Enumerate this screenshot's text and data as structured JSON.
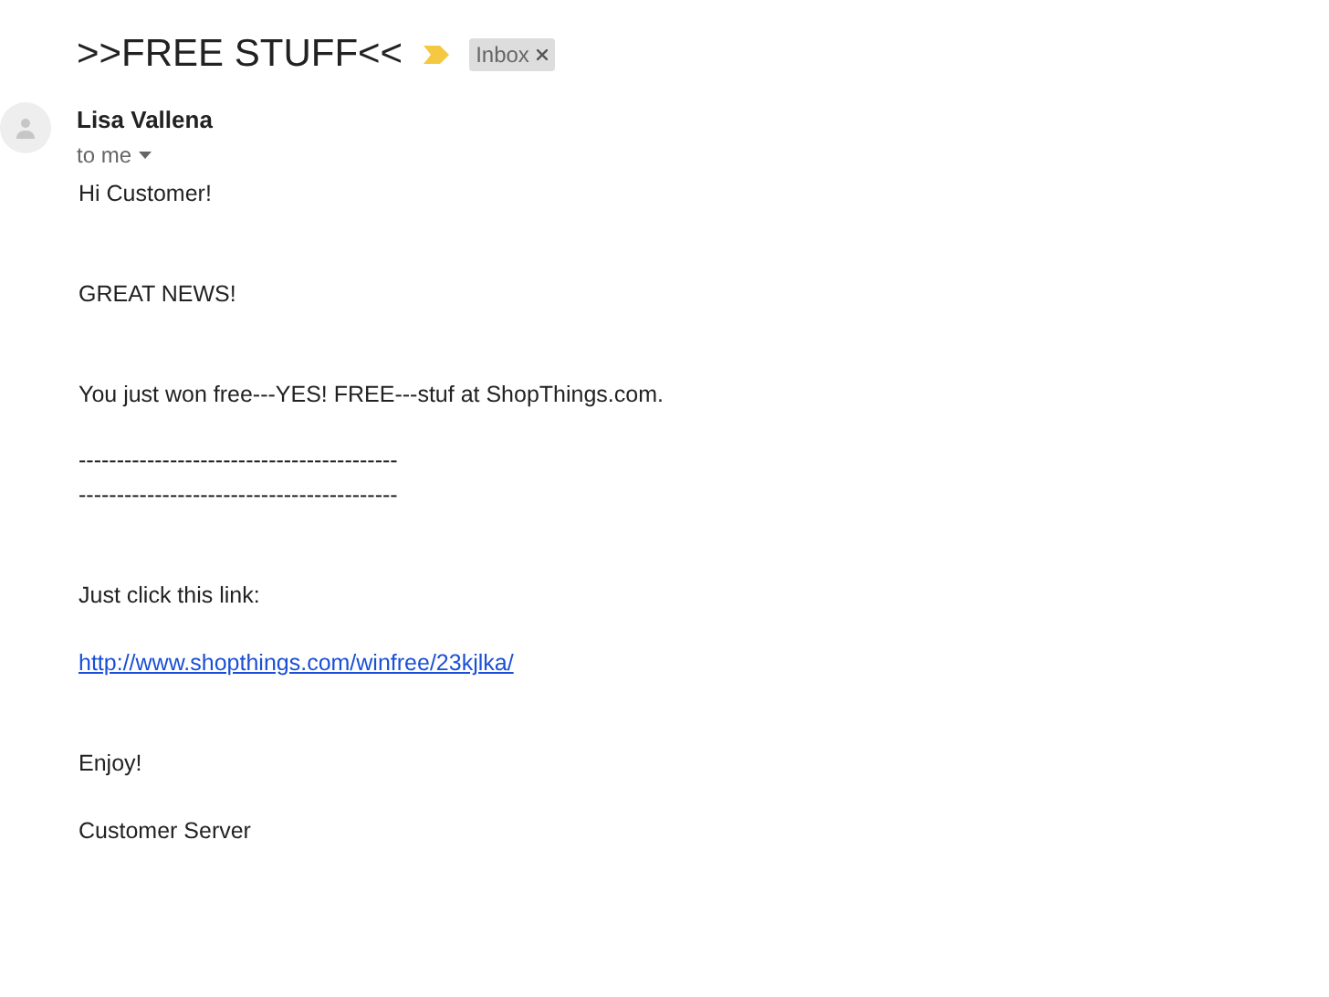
{
  "subject": ">>FREE STUFF<<",
  "important": true,
  "labels": [
    {
      "text": "Inbox",
      "removable": true
    }
  ],
  "sender": {
    "name": "Lisa Vallena",
    "recipient": "to me"
  },
  "body": [
    {
      "kind": "text",
      "text": "Hi Customer!"
    },
    {
      "kind": "text",
      "text": "GREAT NEWS!"
    },
    {
      "kind": "text",
      "text": "You just won free---YES! FREE---stuf at ShopThings.com."
    },
    {
      "kind": "text",
      "text": "------------------------------------------"
    },
    {
      "kind": "text",
      "text": "------------------------------------------"
    },
    {
      "kind": "text",
      "text": "Just click this link:"
    },
    {
      "kind": "link",
      "text": "http://www.shopthings.com/winfree/23kjlka/"
    },
    {
      "kind": "text",
      "text": "Enjoy!"
    },
    {
      "kind": "text",
      "text": "Customer Server"
    }
  ]
}
